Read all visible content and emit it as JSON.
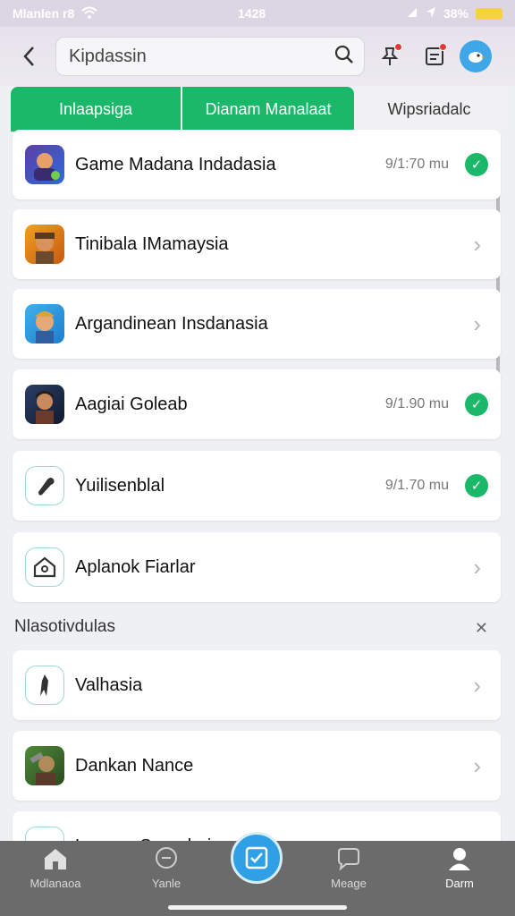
{
  "status": {
    "carrier": "Mlanlen r8",
    "time": "1428",
    "battery": "38%"
  },
  "header": {
    "search_value": "Kipdassin"
  },
  "tabs": [
    {
      "label": "Inlaapsiga"
    },
    {
      "label": "Dianam Manalaat"
    },
    {
      "label": "Wipsriadalc"
    }
  ],
  "items": [
    {
      "label": "Game Madana Indadasia",
      "meta": "9/1:70 mu",
      "status": "check"
    },
    {
      "label": "Tinibala IMamaysia",
      "meta": "",
      "status": "chevron"
    },
    {
      "label": "Argandinean Insdanasia",
      "meta": "",
      "status": "chevron"
    },
    {
      "label": "Aagiai Goleab",
      "meta": "9/1.90 mu",
      "status": "check"
    },
    {
      "label": "Yuilisenblal",
      "meta": "9/1.70 mu",
      "status": "check"
    },
    {
      "label": "Aplanok Fiarlar",
      "meta": "",
      "status": "chevron"
    }
  ],
  "section": {
    "title": "Nlasotivdulas",
    "action": "✕"
  },
  "items2": [
    {
      "label": "Valhasia"
    },
    {
      "label": "Dankan Nance"
    },
    {
      "label": "Lnanaa Sanadaria"
    }
  ],
  "nav": [
    {
      "label": "Mdlanaoa"
    },
    {
      "label": "Yanle"
    },
    {
      "label": "Meage"
    },
    {
      "label": "Darm"
    }
  ]
}
